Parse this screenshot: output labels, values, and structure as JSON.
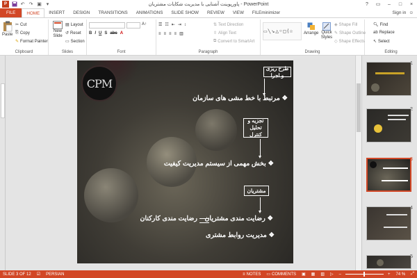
{
  "titlebar": {
    "title": "پاورپوینت آشنایی با مدیریت شکایات مشتریان - PowerPoint",
    "qat": [
      "save-icon",
      "undo-icon",
      "redo-icon",
      "start-from-beginning-icon",
      "customize-icon"
    ],
    "controls": [
      "?",
      "▭",
      "–",
      "□",
      "×"
    ]
  },
  "tabs": [
    "FILE",
    "HOME",
    "INSERT",
    "DESIGN",
    "TRANSITIONS",
    "ANIMATIONS",
    "SLIDE SHOW",
    "REVIEW",
    "VIEW",
    "FILEminimizer"
  ],
  "active_tab": "HOME",
  "signin": "Sign in",
  "ribbon": {
    "clipboard": {
      "label": "Clipboard",
      "paste": "Paste",
      "cut": "Cut",
      "copy": "Copy",
      "format_painter": "Format Painter"
    },
    "slides": {
      "label": "Slides",
      "new_slide": "New Slide",
      "layout": "Layout",
      "reset": "Reset",
      "section": "Section"
    },
    "font": {
      "label": "Font"
    },
    "paragraph": {
      "label": "Paragraph",
      "text_direction": "Text Direction",
      "align_text": "Align Text",
      "convert_smartart": "Convert to SmartArt"
    },
    "drawing": {
      "label": "Drawing",
      "arrange": "Arrange",
      "quick_styles": "Quick Styles",
      "shape_fill": "Shape Fill",
      "shape_outline": "Shape Outline",
      "shape_effects": "Shape Effects"
    },
    "editing": {
      "label": "Editing",
      "find": "Find",
      "replace": "Replace",
      "select": "Select"
    }
  },
  "slide": {
    "logo_text": "CPM",
    "box1": "طرح ریزی و اجرا",
    "bullet1": "مرتبط با خط مشی های سازمان",
    "box2": "تجزیه و تحلیل\nکنترل",
    "bullet2": "بخش مهمی از سیستم مدیریت کیفیت",
    "box3": "مشتریان",
    "bullet3_right": "رضایت مندی مشتریان",
    "bullet3_left": "رضایت مندی کارکنان",
    "bullet4": "مدیریت روابط مشتری",
    "bullet_glyph": "❖"
  },
  "thumbnails": [
    {
      "num": "1",
      "active": false
    },
    {
      "num": "2",
      "active": false
    },
    {
      "num": "3",
      "active": true
    },
    {
      "num": "4",
      "active": false
    },
    {
      "num": "5",
      "active": false
    }
  ],
  "status": {
    "slide_info": "SLIDE 3 OF 12",
    "language": "PERSIAN",
    "notes": "NOTES",
    "comments": "COMMENTS",
    "zoom": "74 %"
  },
  "colors": {
    "accent": "#d24726",
    "status_bar": "#d24726"
  }
}
